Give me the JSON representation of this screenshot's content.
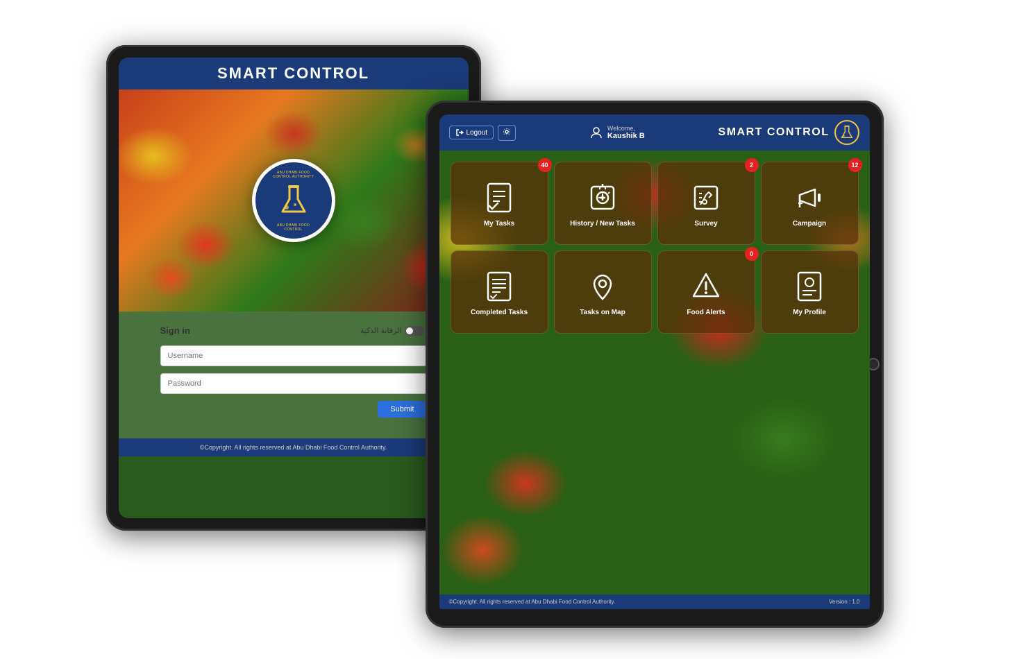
{
  "left_tablet": {
    "header_title": "SMART CONTROL",
    "logo_text_top": "ABU DHABI FOOD CONTROL AUTHORITY",
    "form": {
      "sign_in_label": "Sign in",
      "arabic_label": "الرقابة الذكية",
      "username_placeholder": "Username",
      "password_placeholder": "Password",
      "submit_label": "Submit"
    },
    "footer_text": "©Copyright. All rights reserved at Abu Dhabi Food Control Authority."
  },
  "right_tablet": {
    "header": {
      "logout_label": "Logout",
      "welcome_label": "Welcome,",
      "user_name": "Kaushik B",
      "brand_title": "SMART CONTROL"
    },
    "grid_items": [
      {
        "label": "My Tasks",
        "badge": "40",
        "icon": "tasks"
      },
      {
        "label": "History / New Tasks",
        "badge": null,
        "icon": "history"
      },
      {
        "label": "Survey",
        "badge": "2",
        "icon": "survey"
      },
      {
        "label": "Campaign",
        "badge": "12",
        "icon": "campaign"
      },
      {
        "label": "Completed Tasks",
        "badge": null,
        "icon": "completed"
      },
      {
        "label": "Tasks on Map",
        "badge": null,
        "icon": "map"
      },
      {
        "label": "Food Alerts",
        "badge": "0",
        "icon": "alerts"
      },
      {
        "label": "My Profile",
        "badge": null,
        "icon": "profile"
      }
    ],
    "footer_copyright": "©Copyright. All rights reserved at Abu Dhabi Food Control Authority.",
    "footer_version": "Version : 1.0"
  }
}
